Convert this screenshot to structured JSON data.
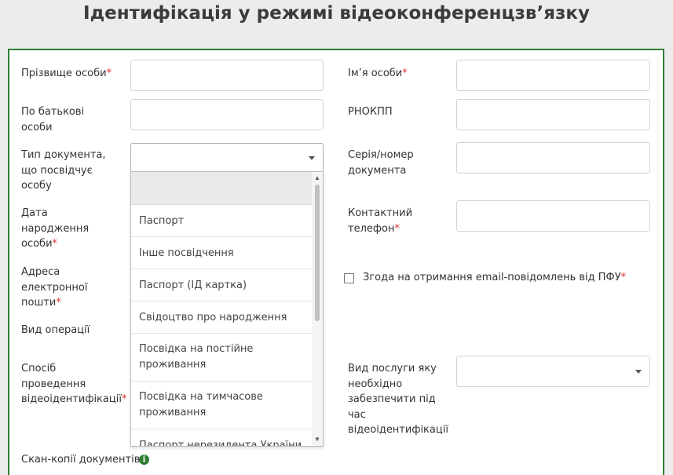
{
  "page": {
    "title": "Ідентифікація у режимі відеоконференцзв’язку"
  },
  "form": {
    "required_mark": "*",
    "surname": {
      "label": "Прізвище особи",
      "value": ""
    },
    "name": {
      "label": "Ім’я особи",
      "value": ""
    },
    "patronymic": {
      "label_line1": "По батькові",
      "label_line2": "особи",
      "value": ""
    },
    "rnokpp": {
      "label": "РНОКПП",
      "value": ""
    },
    "document_type": {
      "label_line1": "Тип документа,",
      "label_line2": "що посвідчує",
      "label_line3": "особу",
      "value": ""
    },
    "document_number": {
      "label_line1": "Серія/номер",
      "label_line2": "документа",
      "value": ""
    },
    "birth_date": {
      "label_line1": "Дата",
      "label_line2": "народження",
      "label_line3": "особи"
    },
    "phone": {
      "label_line1": "Контактний",
      "label_line2": "телефон",
      "value": ""
    },
    "email": {
      "label_line1": "Адреса",
      "label_line2": "електронної",
      "label_line3": "пошти"
    },
    "consent": {
      "label": "Згода на отримання email-повідомлень від ПФУ",
      "checked": false
    },
    "operation_type": {
      "label": "Вид операції"
    },
    "video_method": {
      "label_line1": "Спосіб",
      "label_line2": "проведення",
      "label_line3": "відеоідентифікації"
    },
    "service_type": {
      "label_line1": "Вид послуги яку",
      "label_line2": "необхідно",
      "label_line3": "забезпечити під",
      "label_line4": "час",
      "label_line5": "відеоідентифікації",
      "value": ""
    },
    "scans": {
      "label": "Скан-копії документів"
    }
  },
  "dropdown": {
    "options": [
      "",
      "Паспорт",
      "Інше посвідчення",
      "Паспорт (ІД картка)",
      "Свідоцтво про народження",
      "Посвідка на постійне проживання",
      "Посвідка на тимчасове проживання",
      "Паспорт нерезидента України"
    ],
    "option_lines": {
      "o5_l1": "Посвідка на постійне",
      "o5_l2": "проживання",
      "o6_l1": "Посвідка на тимчасове",
      "o6_l2": "проживання"
    }
  },
  "colors": {
    "accent": "#2e7d32",
    "required": "#d9302c",
    "background": "#ececec"
  }
}
